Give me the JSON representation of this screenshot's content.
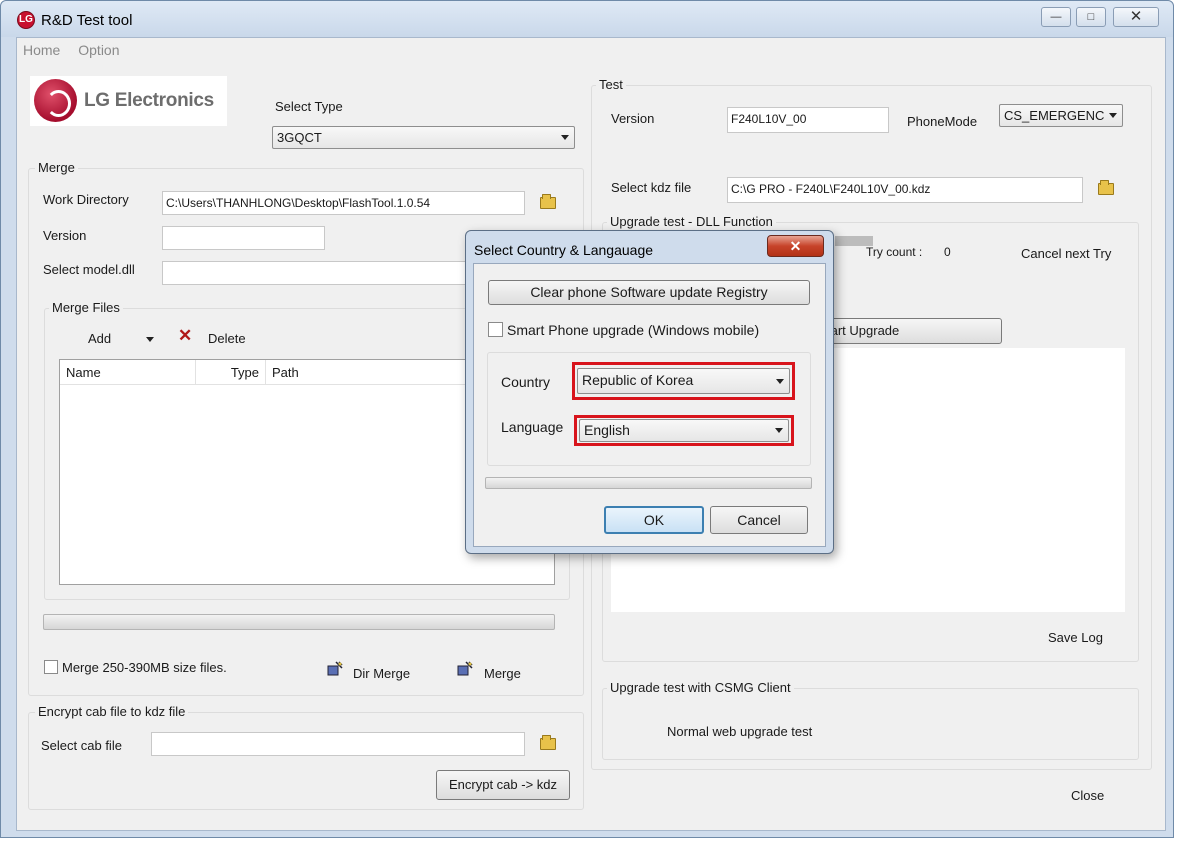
{
  "window": {
    "title": "R&D Test tool",
    "logo_badge": "LG",
    "minimize": "—",
    "maximize": "□",
    "close": "✕"
  },
  "menu": [
    "Home",
    "Option"
  ],
  "logo": {
    "text": "LG Electronics"
  },
  "select_type": {
    "label": "Select Type",
    "value": "3GQCT"
  },
  "merge": {
    "title": "Merge",
    "work_directory_label": "Work Directory",
    "work_directory_value": "C:\\Users\\THANHLONG\\Desktop\\FlashTool.1.0.54",
    "version_label": "Version",
    "version_value": "",
    "model_dll_label": "Select model.dll",
    "model_dll_value": "",
    "files_title": "Merge Files",
    "add_label": "Add",
    "delete_label": "Delete",
    "columns": [
      "Name",
      "Type",
      "Path"
    ],
    "checkbox_label": "Merge 250-390MB size files.",
    "dir_merge_label": "Dir Merge",
    "merge_label": "Merge"
  },
  "encrypt": {
    "title": "Encrypt cab file to kdz file",
    "select_cab_label": "Select cab file",
    "select_cab_value": "",
    "button_label": "Encrypt cab -> kdz"
  },
  "test": {
    "title": "Test",
    "version_label": "Version",
    "version_value": "F240L10V_00",
    "phone_mode_label": "PhoneMode",
    "phone_mode_value": "CS_EMERGENC",
    "kdz_label": "Select kdz file",
    "kdz_value": "C:\\G PRO - F240L\\F240L10V_00.kdz",
    "upgrade_dll_title": "Upgrade test - DLL Function",
    "try_count_label": "Try count :",
    "try_count_value": "0",
    "cancel_next_try": "Cancel next Try",
    "start_upgrade_label": "tart Upgrade",
    "save_log": "Save Log",
    "csmg_title": "Upgrade test with CSMG Client",
    "normal_web_upgrade": "Normal web upgrade test",
    "close_label": "Close"
  },
  "dialog": {
    "title": "Select Country & Langauage",
    "close_glyph": "✕",
    "clear_registry_label": "Clear phone Software update Registry",
    "smart_phone_label": "Smart Phone upgrade (Windows mobile)",
    "country_label": "Country",
    "country_value": "Republic of Korea",
    "language_label": "Language",
    "language_value": "English",
    "ok_label": "OK",
    "cancel_label": "Cancel"
  },
  "colors": {
    "highlight_red": "#d8141c",
    "lg_red": "#a50d2d"
  }
}
